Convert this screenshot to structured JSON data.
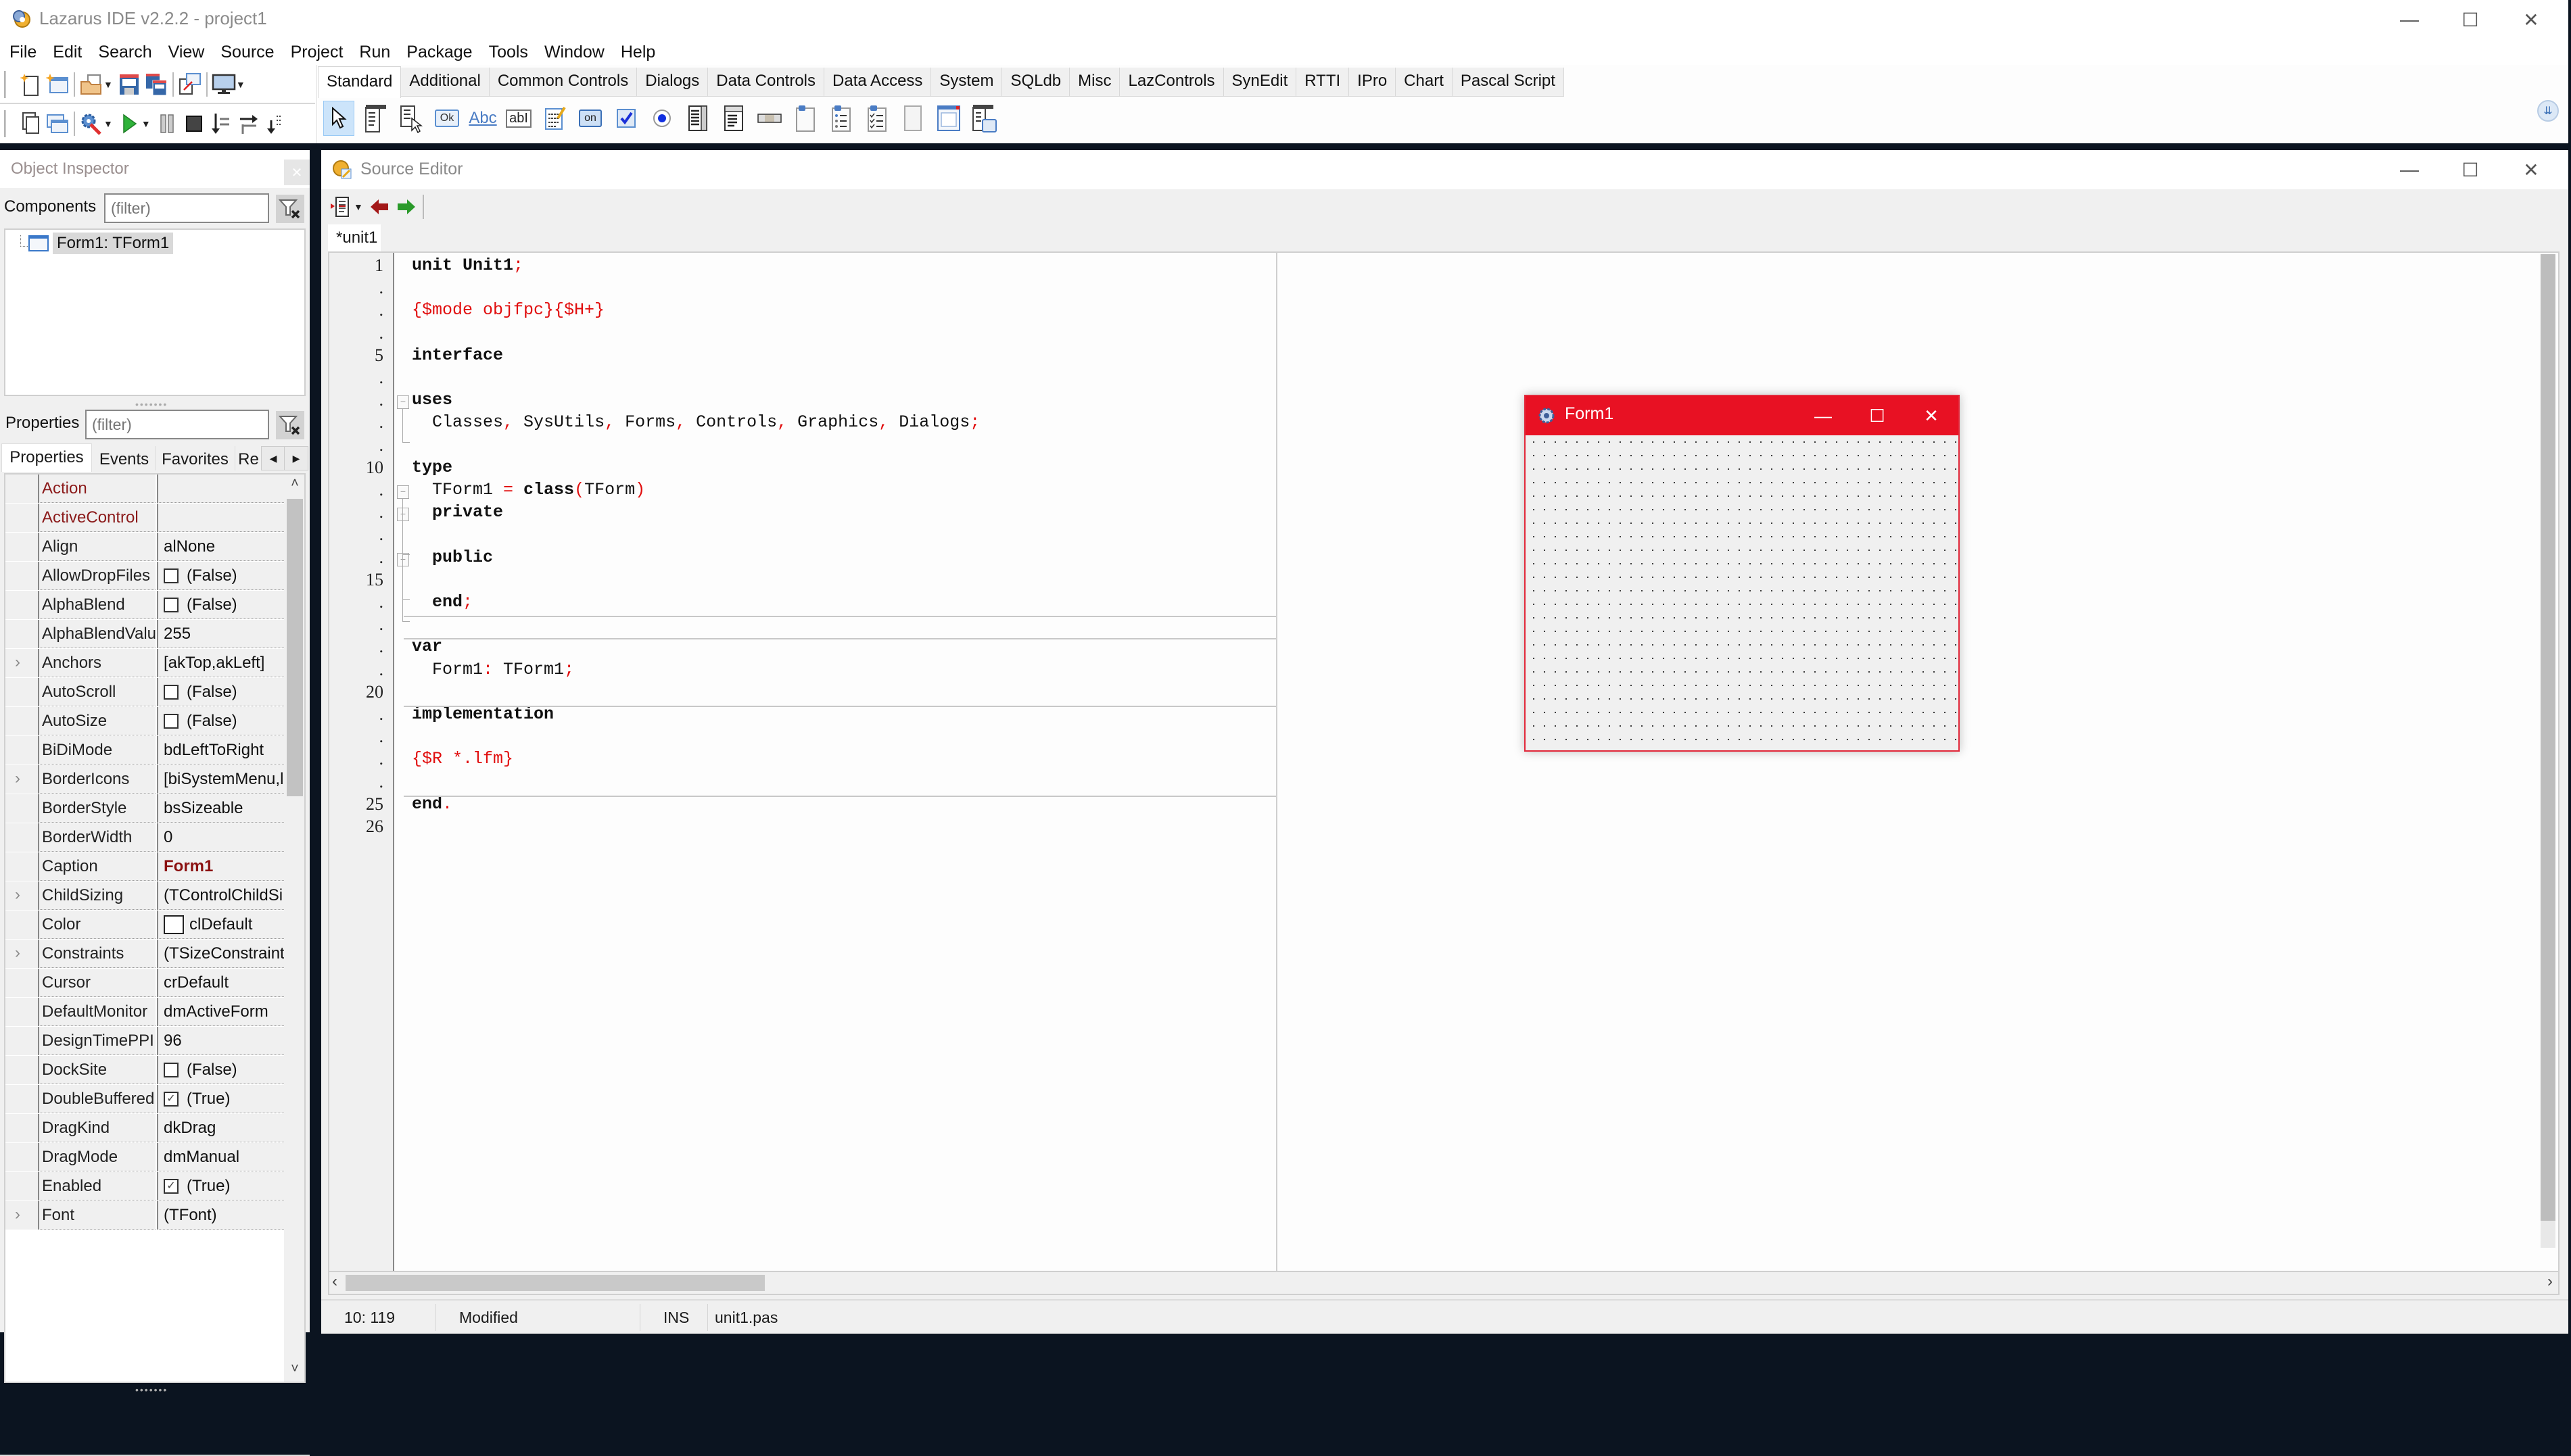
{
  "main_window": {
    "title": "Lazarus IDE v2.2.2 - project1",
    "controls": {
      "minimize": "—",
      "maximize": "☐",
      "close": "✕"
    }
  },
  "menu": [
    "File",
    "Edit",
    "Search",
    "View",
    "Source",
    "Project",
    "Run",
    "Package",
    "Tools",
    "Window",
    "Help"
  ],
  "toolbar": {
    "row1": [
      "new-unit",
      "new-form",
      "open",
      "save",
      "save-all",
      "toggle-form-unit",
      "view-forms"
    ],
    "row2": [
      "view-units",
      "view-forms-list",
      "build-options",
      "run",
      "pause",
      "stop",
      "step-into",
      "step-over",
      "step-out"
    ]
  },
  "palette": {
    "tabs": [
      "Standard",
      "Additional",
      "Common Controls",
      "Dialogs",
      "Data Controls",
      "Data Access",
      "System",
      "SQLdb",
      "Misc",
      "LazControls",
      "SynEdit",
      "RTTI",
      "IPro",
      "Chart",
      "Pascal Script"
    ],
    "active_tab": "Standard",
    "components": [
      "pointer",
      "TMainMenu",
      "TPopupMenu",
      "TButton",
      "TLabel",
      "TEdit",
      "TMemo",
      "TToggleBox",
      "TCheckBox",
      "TRadioButton",
      "TListBox",
      "TComboBox",
      "TScrollBar",
      "TGroupBox",
      "TRadioGroup",
      "TCheckGroup",
      "TPanel",
      "TFrame",
      "TActionList"
    ],
    "component_labels": {
      "TButton": "Ok",
      "TLabel": "Abc",
      "TEdit": "abI",
      "TToggleBox": "on"
    }
  },
  "object_inspector": {
    "title": "Object Inspector",
    "components_label": "Components",
    "components_filter_placeholder": "(filter)",
    "tree": [
      {
        "label": "Form1: TForm1"
      }
    ],
    "properties_label": "Properties",
    "properties_filter_placeholder": "(filter)",
    "tabs": [
      "Properties",
      "Events",
      "Favorites",
      "Re"
    ],
    "active_tab": "Properties",
    "properties": [
      {
        "name": "Action",
        "value": "",
        "kind": "event"
      },
      {
        "name": "ActiveControl",
        "value": "",
        "kind": "event"
      },
      {
        "name": "Align",
        "value": "alNone"
      },
      {
        "name": "AllowDropFiles",
        "value": "(False)",
        "checkbox": false
      },
      {
        "name": "AlphaBlend",
        "value": "(False)",
        "checkbox": false
      },
      {
        "name": "AlphaBlendValu",
        "value": "255"
      },
      {
        "name": "Anchors",
        "value": "[akTop,akLeft]",
        "expandable": true
      },
      {
        "name": "AutoScroll",
        "value": "(False)",
        "checkbox": false
      },
      {
        "name": "AutoSize",
        "value": "(False)",
        "checkbox": false
      },
      {
        "name": "BiDiMode",
        "value": "bdLeftToRight"
      },
      {
        "name": "BorderIcons",
        "value": "[biSystemMenu,l",
        "expandable": true
      },
      {
        "name": "BorderStyle",
        "value": "bsSizeable"
      },
      {
        "name": "BorderWidth",
        "value": "0"
      },
      {
        "name": "Caption",
        "value": "Form1",
        "bold": true
      },
      {
        "name": "ChildSizing",
        "value": "(TControlChildSi:",
        "expandable": true
      },
      {
        "name": "Color",
        "value": "clDefault",
        "color_swatch": "#ffffff"
      },
      {
        "name": "Constraints",
        "value": "(TSizeConstraints",
        "expandable": true
      },
      {
        "name": "Cursor",
        "value": "crDefault"
      },
      {
        "name": "DefaultMonitor",
        "value": "dmActiveForm"
      },
      {
        "name": "DesignTimePPI",
        "value": "96"
      },
      {
        "name": "DockSite",
        "value": "(False)",
        "checkbox": false
      },
      {
        "name": "DoubleBuffered",
        "value": "(True)",
        "checkbox": true
      },
      {
        "name": "DragKind",
        "value": "dkDrag"
      },
      {
        "name": "DragMode",
        "value": "dmManual"
      },
      {
        "name": "Enabled",
        "value": "(True)",
        "checkbox": true
      },
      {
        "name": "Font",
        "value": "(TFont)",
        "expandable": true
      }
    ]
  },
  "source_editor": {
    "title": "Source Editor",
    "tab": "*unit1",
    "line_numbers": [
      "1",
      ".",
      ".",
      ".",
      "5",
      ".",
      ".",
      ".",
      ".",
      "10",
      ".",
      ".",
      ".",
      ".",
      "15",
      ".",
      ".",
      ".",
      ".",
      "20",
      ".",
      ".",
      ".",
      ".",
      "25",
      "26"
    ],
    "lines": [
      [
        {
          "t": "unit Unit1",
          "c": "kw"
        },
        {
          "t": ";",
          "c": "sym"
        }
      ],
      [],
      [
        {
          "t": "{$mode objfpc}{$H+}",
          "c": "dir"
        }
      ],
      [],
      [
        {
          "t": "interface",
          "c": "kw"
        }
      ],
      [],
      [
        {
          "t": "uses",
          "c": "kw"
        }
      ],
      [
        {
          "t": "  Classes"
        },
        {
          "t": ",",
          "c": "sym"
        },
        {
          "t": " SysUtils"
        },
        {
          "t": ",",
          "c": "sym"
        },
        {
          "t": " Forms"
        },
        {
          "t": ",",
          "c": "sym"
        },
        {
          "t": " Controls"
        },
        {
          "t": ",",
          "c": "sym"
        },
        {
          "t": " Graphics"
        },
        {
          "t": ",",
          "c": "sym"
        },
        {
          "t": " Dialogs"
        },
        {
          "t": ";",
          "c": "sym"
        }
      ],
      [],
      [
        {
          "t": "type",
          "c": "kw"
        }
      ],
      [
        {
          "t": "  TForm1 "
        },
        {
          "t": "=",
          "c": "sym"
        },
        {
          "t": " class",
          "c": "kw"
        },
        {
          "t": "(",
          "c": "sym"
        },
        {
          "t": "TForm"
        },
        {
          "t": ")",
          "c": "sym"
        }
      ],
      [
        {
          "t": "  private",
          "c": "kw"
        }
      ],
      [],
      [
        {
          "t": "  public",
          "c": "kw"
        }
      ],
      [],
      [
        {
          "t": "  end",
          "c": "kw"
        },
        {
          "t": ";",
          "c": "sym"
        }
      ],
      [],
      [
        {
          "t": "var",
          "c": "kw"
        }
      ],
      [
        {
          "t": "  Form1"
        },
        {
          "t": ":",
          "c": "sym"
        },
        {
          "t": " TForm1"
        },
        {
          "t": ";",
          "c": "sym"
        }
      ],
      [],
      [
        {
          "t": "implementation",
          "c": "kw"
        }
      ],
      [],
      [
        {
          "t": "{$R *.lfm}",
          "c": "dir"
        }
      ],
      [],
      [
        {
          "t": "end",
          "c": "kw"
        },
        {
          "t": ".",
          "c": "sym"
        }
      ],
      []
    ],
    "status": {
      "cursor": "10: 119",
      "modified": "Modified",
      "mode": "INS",
      "file": "unit1.pas"
    }
  },
  "form_designer": {
    "title": "Form1",
    "title_bar_color": "#e81123"
  },
  "colors": {
    "accent_red": "#e81123",
    "directive_red": "#e10e0e",
    "event_prop": "#8b1a1a"
  }
}
